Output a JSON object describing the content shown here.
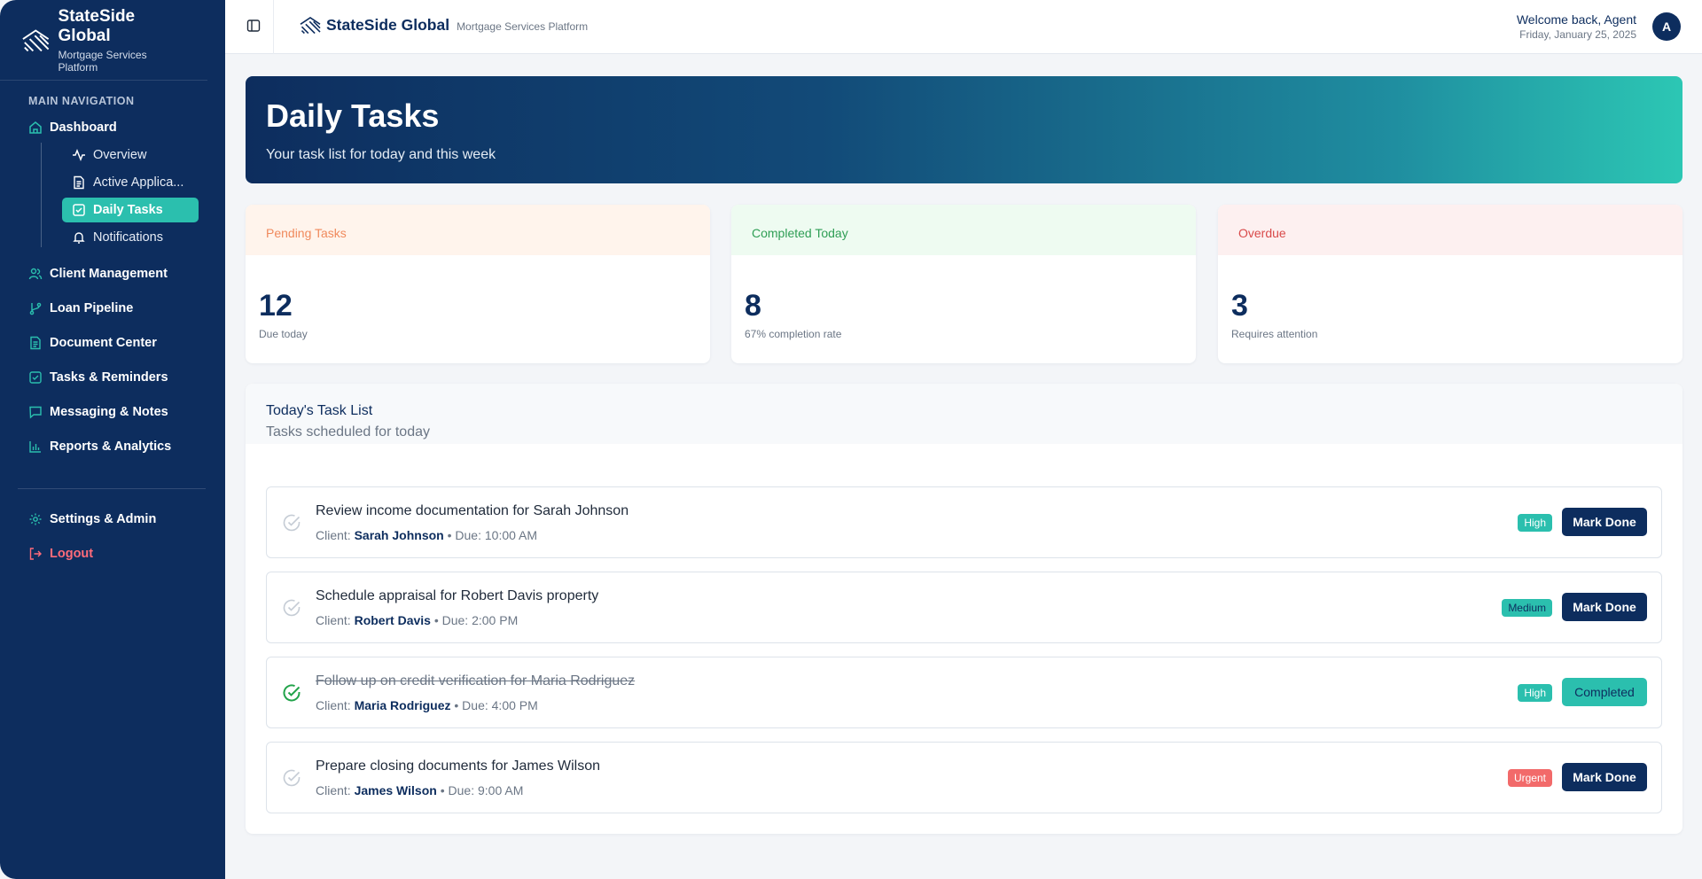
{
  "brand": {
    "name": "StateSide Global",
    "tagline": "Mortgage Services Platform"
  },
  "sidebar": {
    "heading": "MAIN NAVIGATION",
    "dashboard": "Dashboard",
    "sub_items": [
      "Overview",
      "Active Applica...",
      "Daily Tasks",
      "Notifications"
    ],
    "items": [
      "Client Management",
      "Loan Pipeline",
      "Document Center",
      "Tasks & Reminders",
      "Messaging & Notes",
      "Reports & Analytics"
    ],
    "settings": "Settings & Admin",
    "logout": "Logout"
  },
  "topbar": {
    "welcome": "Welcome back, Agent",
    "date": "Friday, January 25, 2025",
    "avatar": "A"
  },
  "hero": {
    "title": "Daily Tasks",
    "subtitle": "Your task list for today and this week"
  },
  "stats": [
    {
      "label": "Pending Tasks",
      "value": "12",
      "note": "Due today",
      "head_bg": "#fff4ec",
      "head_color": "#f08a5d"
    },
    {
      "label": "Completed Today",
      "value": "8",
      "note": "67% completion rate",
      "head_bg": "#eefbf1",
      "head_color": "#2f9e55"
    },
    {
      "label": "Overdue",
      "value": "3",
      "note": "Requires attention",
      "head_bg": "#fdf0f0",
      "head_color": "#d94a4a"
    }
  ],
  "task_list": {
    "title": "Today's Task List",
    "subtitle": "Tasks scheduled for today",
    "client_label": "Client:",
    "due_label": "• Due:",
    "tasks": [
      {
        "title": "Review income documentation for Sarah Johnson",
        "client": "Sarah Johnson",
        "due": "10:00 AM",
        "priority": "High",
        "action": "Mark Done",
        "done": false
      },
      {
        "title": "Schedule appraisal for Robert Davis property",
        "client": "Robert Davis",
        "due": "2:00 PM",
        "priority": "Medium",
        "action": "Mark Done",
        "done": false
      },
      {
        "title": "Follow up on credit verification for Maria Rodriguez",
        "client": "Maria Rodriguez",
        "due": "4:00 PM",
        "priority": "High",
        "action": "Completed",
        "done": true
      },
      {
        "title": "Prepare closing documents for James Wilson",
        "client": "James Wilson",
        "due": "9:00 AM",
        "priority": "Urgent",
        "action": "Mark Done",
        "done": false
      }
    ]
  }
}
